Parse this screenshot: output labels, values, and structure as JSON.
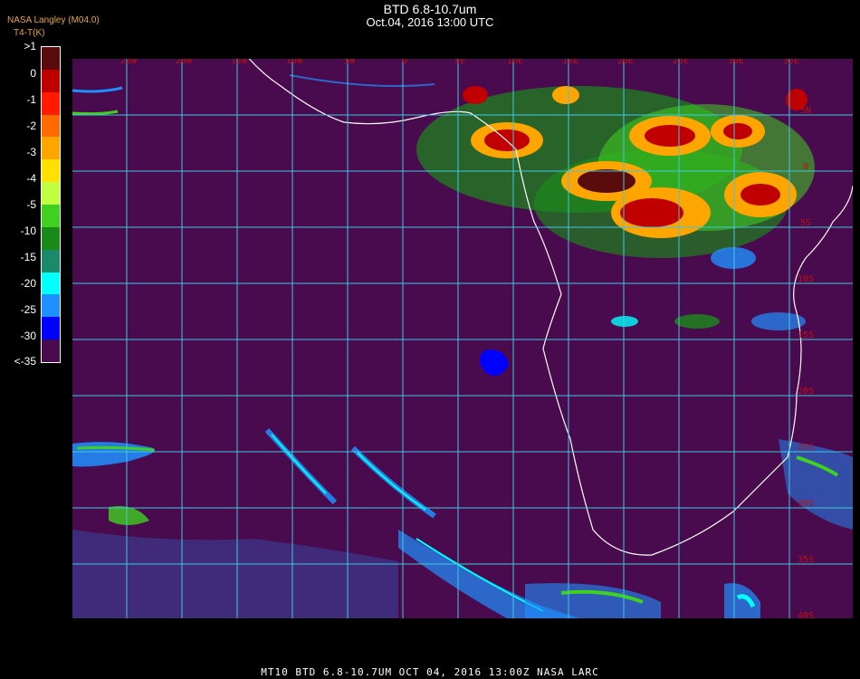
{
  "header": {
    "title": "BTD 6.8-10.7um",
    "subtitle": "Oct.04, 2016 13:00 UTC",
    "credit": "NASA Langley (M04.0)",
    "units": "T4-T(K)"
  },
  "colorbar": {
    "labels": [
      ">1",
      "0",
      "-1",
      "-2",
      "-3",
      "-4",
      "-5",
      "-10",
      "-15",
      "-20",
      "-25",
      "-30",
      "<-35"
    ],
    "colors": [
      "#5a0c0c",
      "#c00000",
      "#ff1a00",
      "#ff6a00",
      "#ffa500",
      "#ffe000",
      "#c0ff40",
      "#40d020",
      "#1a8a1a",
      "#1a8a6a",
      "#00ffff",
      "#1e90ff",
      "#0000ff",
      "#4a0a4e"
    ]
  },
  "map": {
    "background_color": "#4a0a4e",
    "grid_color": "#40c8e0",
    "label_color": "#c01010",
    "lon_labels": [
      "25W",
      "20W",
      "15W",
      "10W",
      "5W",
      "0",
      "5E",
      "10E",
      "15E",
      "20E",
      "25E",
      "30E",
      "35E"
    ],
    "lat_labels": [
      "5N",
      "0",
      "5S",
      "10S",
      "15S",
      "20S",
      "25S",
      "30S",
      "35S",
      "40S"
    ],
    "coastline_color": "#ffffff"
  },
  "footer": {
    "text": "MT10   BTD 6.8-10.7UM   OCT 04, 2016 13:00Z   NASA LARC"
  }
}
